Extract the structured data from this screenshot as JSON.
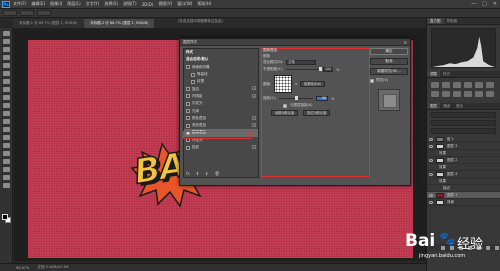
{
  "app": {
    "logo": "Ps",
    "menu": [
      "文件(F)",
      "编辑(E)",
      "图像(I)",
      "图层(L)",
      "文字(Y)",
      "选择(S)",
      "滤镜(T)",
      "3D(D)",
      "视图(V)",
      "窗口(W)",
      "帮助(H)"
    ],
    "window_controls": [
      "—",
      "□",
      "✕"
    ]
  },
  "tabs": [
    {
      "label": "未标题-1 @ 66.7% (图层 1, RGB/8)",
      "active": false
    },
    {
      "label": "未标题-2 @ 66.7% (图层 1, RGB/8)",
      "active": true
    }
  ],
  "document_title": "(在此文档中将图像标注至此)",
  "status": {
    "zoom": "66.67%",
    "doc": "文档:3.44M/43.1M"
  },
  "canvas": {
    "text": "BAZ",
    "background_color": "#c43d53",
    "text_color": "#f3c43f",
    "burst_color": "#e8552a"
  },
  "dialog": {
    "title": "图层样式",
    "style_list": [
      {
        "label": "样式",
        "head": true
      },
      {
        "label": "混合选项:默认",
        "head": true
      },
      {
        "label": "斜面和浮雕",
        "cb": true,
        "checked": false
      },
      {
        "label": "等高线",
        "cb": true,
        "checked": false,
        "indent": true
      },
      {
        "label": "纹理",
        "cb": true,
        "checked": false,
        "indent": true
      },
      {
        "label": "描边",
        "cb": true,
        "checked": false,
        "plus": true
      },
      {
        "label": "内阴影",
        "cb": true,
        "checked": false,
        "plus": true
      },
      {
        "label": "内发光",
        "cb": true,
        "checked": false
      },
      {
        "label": "光泽",
        "cb": true,
        "checked": false
      },
      {
        "label": "颜色叠加",
        "cb": true,
        "checked": false,
        "plus": true
      },
      {
        "label": "渐变叠加",
        "cb": true,
        "checked": false,
        "plus": true
      },
      {
        "label": "图案叠加",
        "cb": true,
        "checked": true,
        "selected": true
      },
      {
        "label": "外发光",
        "cb": true,
        "checked": false
      },
      {
        "label": "投影",
        "cb": true,
        "checked": false,
        "plus": true
      }
    ],
    "list_footer": [
      "fx",
      "⬆",
      "⬇",
      "🗑"
    ],
    "pattern": {
      "group_title": "图案叠加",
      "sub_title": "图案",
      "blend_label": "混合模式(B):",
      "blend_value": "正常",
      "opacity_label": "不透明度(Y):",
      "opacity_value": "100",
      "opacity_level": 1.0,
      "percent": "%",
      "pattern_label": "图案:",
      "snap_button": "贴紧原点(A)",
      "scale_label": "缩放(S):",
      "scale_value": "50",
      "scale_level": 0.5,
      "link_label": "与图层链接(K)",
      "default_button": "设置为默认值",
      "reset_button": "复位为默认值"
    },
    "buttons": {
      "ok": "确定",
      "cancel": "取消",
      "new_style": "新建样式(W)...",
      "preview": "预览(V)"
    }
  },
  "panels": {
    "top_tabs": [
      "直方图",
      "导航器"
    ],
    "adj_tabs": [
      "调整",
      "样式"
    ],
    "layer_tabs": [
      "图层",
      "通道",
      "路径"
    ],
    "layers": [
      {
        "name": "组 1",
        "thumb": "folder"
      },
      {
        "name": "图层 3",
        "thumb": "white"
      },
      {
        "name": "效果",
        "thumb": "none"
      },
      {
        "name": "图层 2",
        "thumb": "white"
      },
      {
        "name": "效果",
        "thumb": "none"
      },
      {
        "name": "图层 4",
        "thumb": "white"
      },
      {
        "name": "效果",
        "thumb": "none"
      },
      {
        "name": "描边",
        "thumb": "none"
      },
      {
        "name": "图层 1",
        "thumb": "red",
        "selected": true
      },
      {
        "name": "背景",
        "thumb": "white"
      }
    ]
  },
  "watermark": {
    "brand_b": "Bai",
    "brand_paw": "🐾",
    "brand_e": "经验",
    "url": "jingyan.baidu.com"
  }
}
